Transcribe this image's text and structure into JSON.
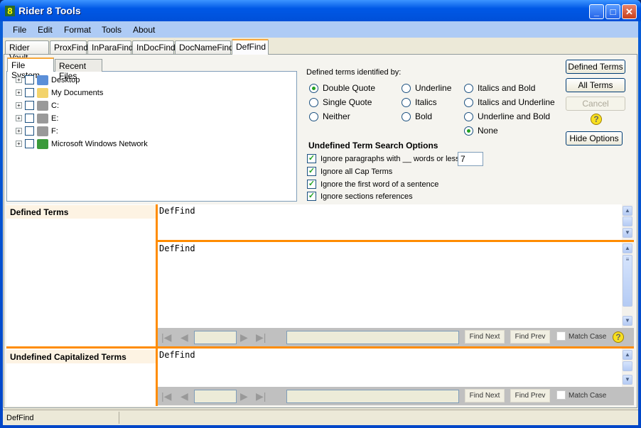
{
  "window": {
    "title": "Rider 8 Tools",
    "app_icon": "8"
  },
  "menu": [
    "File",
    "Edit",
    "Format",
    "Tools",
    "About"
  ],
  "tabs": [
    "Rider Vault",
    "ProxFind",
    "InParaFind",
    "InDocFind",
    "DocNameFind",
    "DefFind"
  ],
  "active_tab": "DefFind",
  "subtabs": [
    "File System",
    "Recent Files"
  ],
  "tree": [
    {
      "label": "Desktop",
      "icon": "desktop-icon"
    },
    {
      "label": "My Documents",
      "icon": "folder-icon"
    },
    {
      "label": "C:",
      "icon": "drive-icon"
    },
    {
      "label": "E:",
      "icon": "drive-icon"
    },
    {
      "label": "F:",
      "icon": "drive-icon"
    },
    {
      "label": "Microsoft Windows Network",
      "icon": "network-icon"
    }
  ],
  "options": {
    "heading": "Defined terms identified by:",
    "radios": [
      {
        "label": "Double Quote",
        "checked": true
      },
      {
        "label": "Single Quote",
        "checked": false
      },
      {
        "label": "Neither",
        "checked": false
      },
      {
        "label": "Underline",
        "checked": false
      },
      {
        "label": "Italics",
        "checked": false
      },
      {
        "label": "Bold",
        "checked": false
      },
      {
        "label": "Italics and Bold",
        "checked": false
      },
      {
        "label": "Italics and Underline",
        "checked": false
      },
      {
        "label": "Underline and Bold",
        "checked": false
      },
      {
        "label": "None",
        "checked": true
      }
    ],
    "undefined_heading": "Undefined Term Search Options",
    "checks": [
      {
        "label": "Ignore paragraphs with __ words or less",
        "checked": true
      },
      {
        "label": "Ignore all Cap Terms",
        "checked": true
      },
      {
        "label": "Ignore the first word of a sentence",
        "checked": true
      },
      {
        "label": "Ignore sections references",
        "checked": true
      }
    ],
    "word_count": "7"
  },
  "buttons": {
    "defined_terms": "Defined Terms",
    "all_terms": "All Terms",
    "cancel": "Cancel",
    "hide_options": "Hide Options",
    "help": "?"
  },
  "sections": {
    "defined_label": "Defined Terms",
    "undefined_label": "Undefined Capitalized Terms",
    "box1": "DefFind",
    "box2": "DefFind",
    "box3": "DefFind"
  },
  "toolbar": {
    "find_next": "Find Next",
    "find_prev": "Find Prev",
    "match_case": "Match Case"
  },
  "status": "DefFind",
  "colors": {
    "accent": "#ff8c00",
    "titlebar": "#0058e6"
  }
}
